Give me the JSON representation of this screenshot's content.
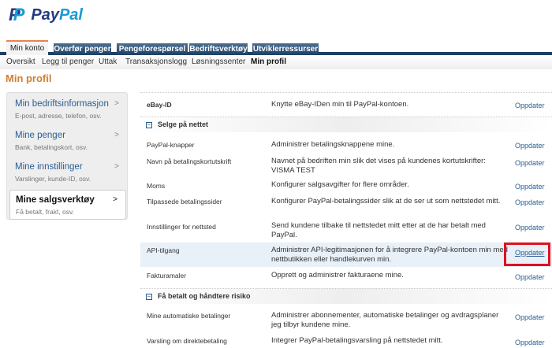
{
  "brand": {
    "name_a": "Pay",
    "name_b": "Pal"
  },
  "tabs": [
    "Min konto",
    "Overfør penger",
    "Pengeforespørsel",
    "Bedriftsverktøy",
    "Utviklerressurser"
  ],
  "subnav": [
    "Oversikt",
    "Legg til penger",
    "Uttak",
    "Transaksjonslogg",
    "Løsningssenter",
    "Min profil"
  ],
  "page_title": "Min profil",
  "sidebar": [
    {
      "title": "Min bedriftsinformasjon",
      "sub": "E-post, adresse, telefon, osv.",
      "chev": ">"
    },
    {
      "title": "Mine penger",
      "sub": "Bank, betalingskort, osv.",
      "chev": ">"
    },
    {
      "title": "Mine innstillinger",
      "sub": "Varslinger, kunde-ID, osv.",
      "chev": ">"
    },
    {
      "title": "Mine salgsverktøy",
      "sub": "Få betalt, frakt, osv.",
      "chev": ">"
    }
  ],
  "sections": {
    "selge": "Selge på nettet",
    "risiko": "Få betalt og håndtere risiko",
    "collapse": "−"
  },
  "rows": [
    {
      "label": "eBay-ID",
      "desc": "Knytte eBay-IDen min til PayPal-kontoen.",
      "action": "Oppdater"
    },
    {
      "label": "PayPal-knapper",
      "desc": "Administrer betalingsknappene mine.",
      "action": "Oppdater"
    },
    {
      "label": "Navn på betalingskortutskrift",
      "desc": "Navnet på bedriften min slik det vises på kundenes kortutskrifter: VISMA TEST",
      "action": "Oppdater"
    },
    {
      "label": "Moms",
      "desc": "Konfigurer salgsavgifter for flere områder.",
      "action": "Oppdater"
    },
    {
      "label": "Tilpassede betalingssider",
      "desc": "Konfigurer PayPal-betalingssider slik at de ser ut som nettstedet mitt.",
      "action": "Oppdater"
    },
    {
      "label": "Innstillinger for nettsted",
      "desc": "Send kundene tilbake til nettstedet mitt etter at de har betalt med PayPal.",
      "action": "Oppdater"
    },
    {
      "label": "API-tilgang",
      "desc": "Administrer API-legitimasjonen for å integrere PayPal-kontoen min med nettbutikken eller handlekurven min.",
      "action": "Oppdater"
    },
    {
      "label": "Fakturamaler",
      "desc": "Opprett og administrer fakturaene mine.",
      "action": "Oppdater"
    },
    {
      "label": "Mine automatiske betalinger",
      "desc": "Administrer abonnementer, automatiske betalinger og avdragsplaner jeg tilbyr kundene mine.",
      "action": "Oppdater"
    },
    {
      "label": "Varsling om direktebetaling",
      "desc": "Integrer PayPal-betalingsvarsling på nettstedet mitt.",
      "action": "Oppdater"
    }
  ]
}
